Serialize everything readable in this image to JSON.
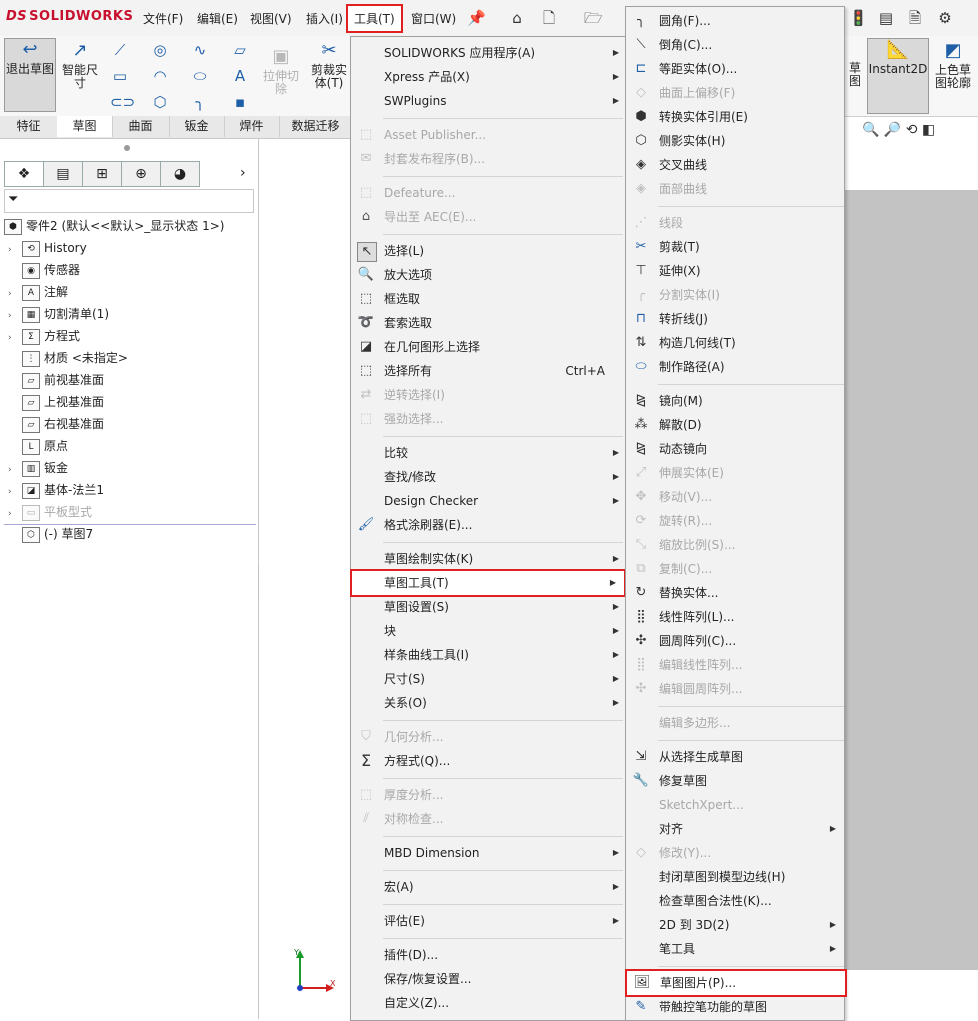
{
  "app": {
    "logo_ds": "DS",
    "logo_name": "SOLIDWORKS"
  },
  "menubar": {
    "items": [
      "文件(F)",
      "编辑(E)",
      "视图(V)",
      "插入(I)",
      "工具(T)",
      "窗口(W)"
    ]
  },
  "ribbon": {
    "exit_sketch": "退出草图",
    "smart_dim_1": "智能尺",
    "smart_dim_2": "寸",
    "extrude_cut_1": "拉伸切",
    "extrude_cut_2": "除",
    "trim_1": "剪裁实",
    "trim_2": "体(T)",
    "instant2d": "Instant2D",
    "color_contour_1": "上色草",
    "color_contour_2": "图轮廓",
    "partial_label_1": "草",
    "partial_label_2": "图"
  },
  "tabs": [
    "特征",
    "草图",
    "曲面",
    "钣金",
    "焊件",
    "数据迁移"
  ],
  "tree": {
    "root": "零件2 (默认<<默认>_显示状态 1>)",
    "items": [
      "History",
      "传感器",
      "注解",
      "切割清单(1)",
      "方程式",
      "材质 <未指定>",
      "前视基准面",
      "上视基准面",
      "右视基准面",
      "原点",
      "钣金",
      "基体-法兰1",
      "平板型式",
      "(-) 草图7"
    ]
  },
  "tools_menu": {
    "items": [
      "SOLIDWORKS 应用程序(A)",
      "Xpress 产品(X)",
      "SWPlugins",
      "Asset Publisher...",
      "封套发布程序(B)...",
      "Defeature...",
      "导出至 AEC(E)...",
      "选择(L)",
      "放大选项",
      "框选取",
      "套索选取",
      "在几何图形上选择",
      "选择所有",
      "逆转选择(I)",
      "强劲选择...",
      "比较",
      "查找/修改",
      "Design Checker",
      "格式涂刷器(E)...",
      "草图绘制实体(K)",
      "草图工具(T)",
      "草图设置(S)",
      "块",
      "样条曲线工具(I)",
      "尺寸(S)",
      "关系(O)",
      "几何分析...",
      "方程式(Q)...",
      "厚度分析...",
      "对称检查...",
      "MBD Dimension",
      "宏(A)",
      "评估(E)",
      "插件(D)...",
      "保存/恢复设置...",
      "自定义(Z)..."
    ],
    "select_all_shortcut": "Ctrl+A"
  },
  "sketch_tools_menu": {
    "items": [
      "圆角(F)...",
      "倒角(C)...",
      "等距实体(O)...",
      "曲面上偏移(F)",
      "转换实体引用(E)",
      "侧影实体(H)",
      "交叉曲线",
      "面部曲线",
      "线段",
      "剪裁(T)",
      "延伸(X)",
      "分割实体(I)",
      "转折线(J)",
      "构造几何线(T)",
      "制作路径(A)",
      "镜向(M)",
      "解散(D)",
      "动态镜向",
      "伸展实体(E)",
      "移动(V)...",
      "旋转(R)...",
      "缩放比例(S)...",
      "复制(C)...",
      "替换实体...",
      "线性阵列(L)...",
      "圆周阵列(C)...",
      "编辑线性阵列...",
      "编辑圆周阵列...",
      "编辑多边形...",
      "从选择生成草图",
      "修复草图",
      "SketchXpert...",
      "对齐",
      "修改(Y)...",
      "封闭草图到模型边线(H)",
      "检查草图合法性(K)...",
      "2D 到 3D(2)",
      "笔工具",
      "草图图片(P)...",
      "带触控笔功能的草图"
    ]
  },
  "colors": {
    "highlight": "#e02020",
    "accent": "#1f5fa8",
    "brand": "#c8102e"
  }
}
